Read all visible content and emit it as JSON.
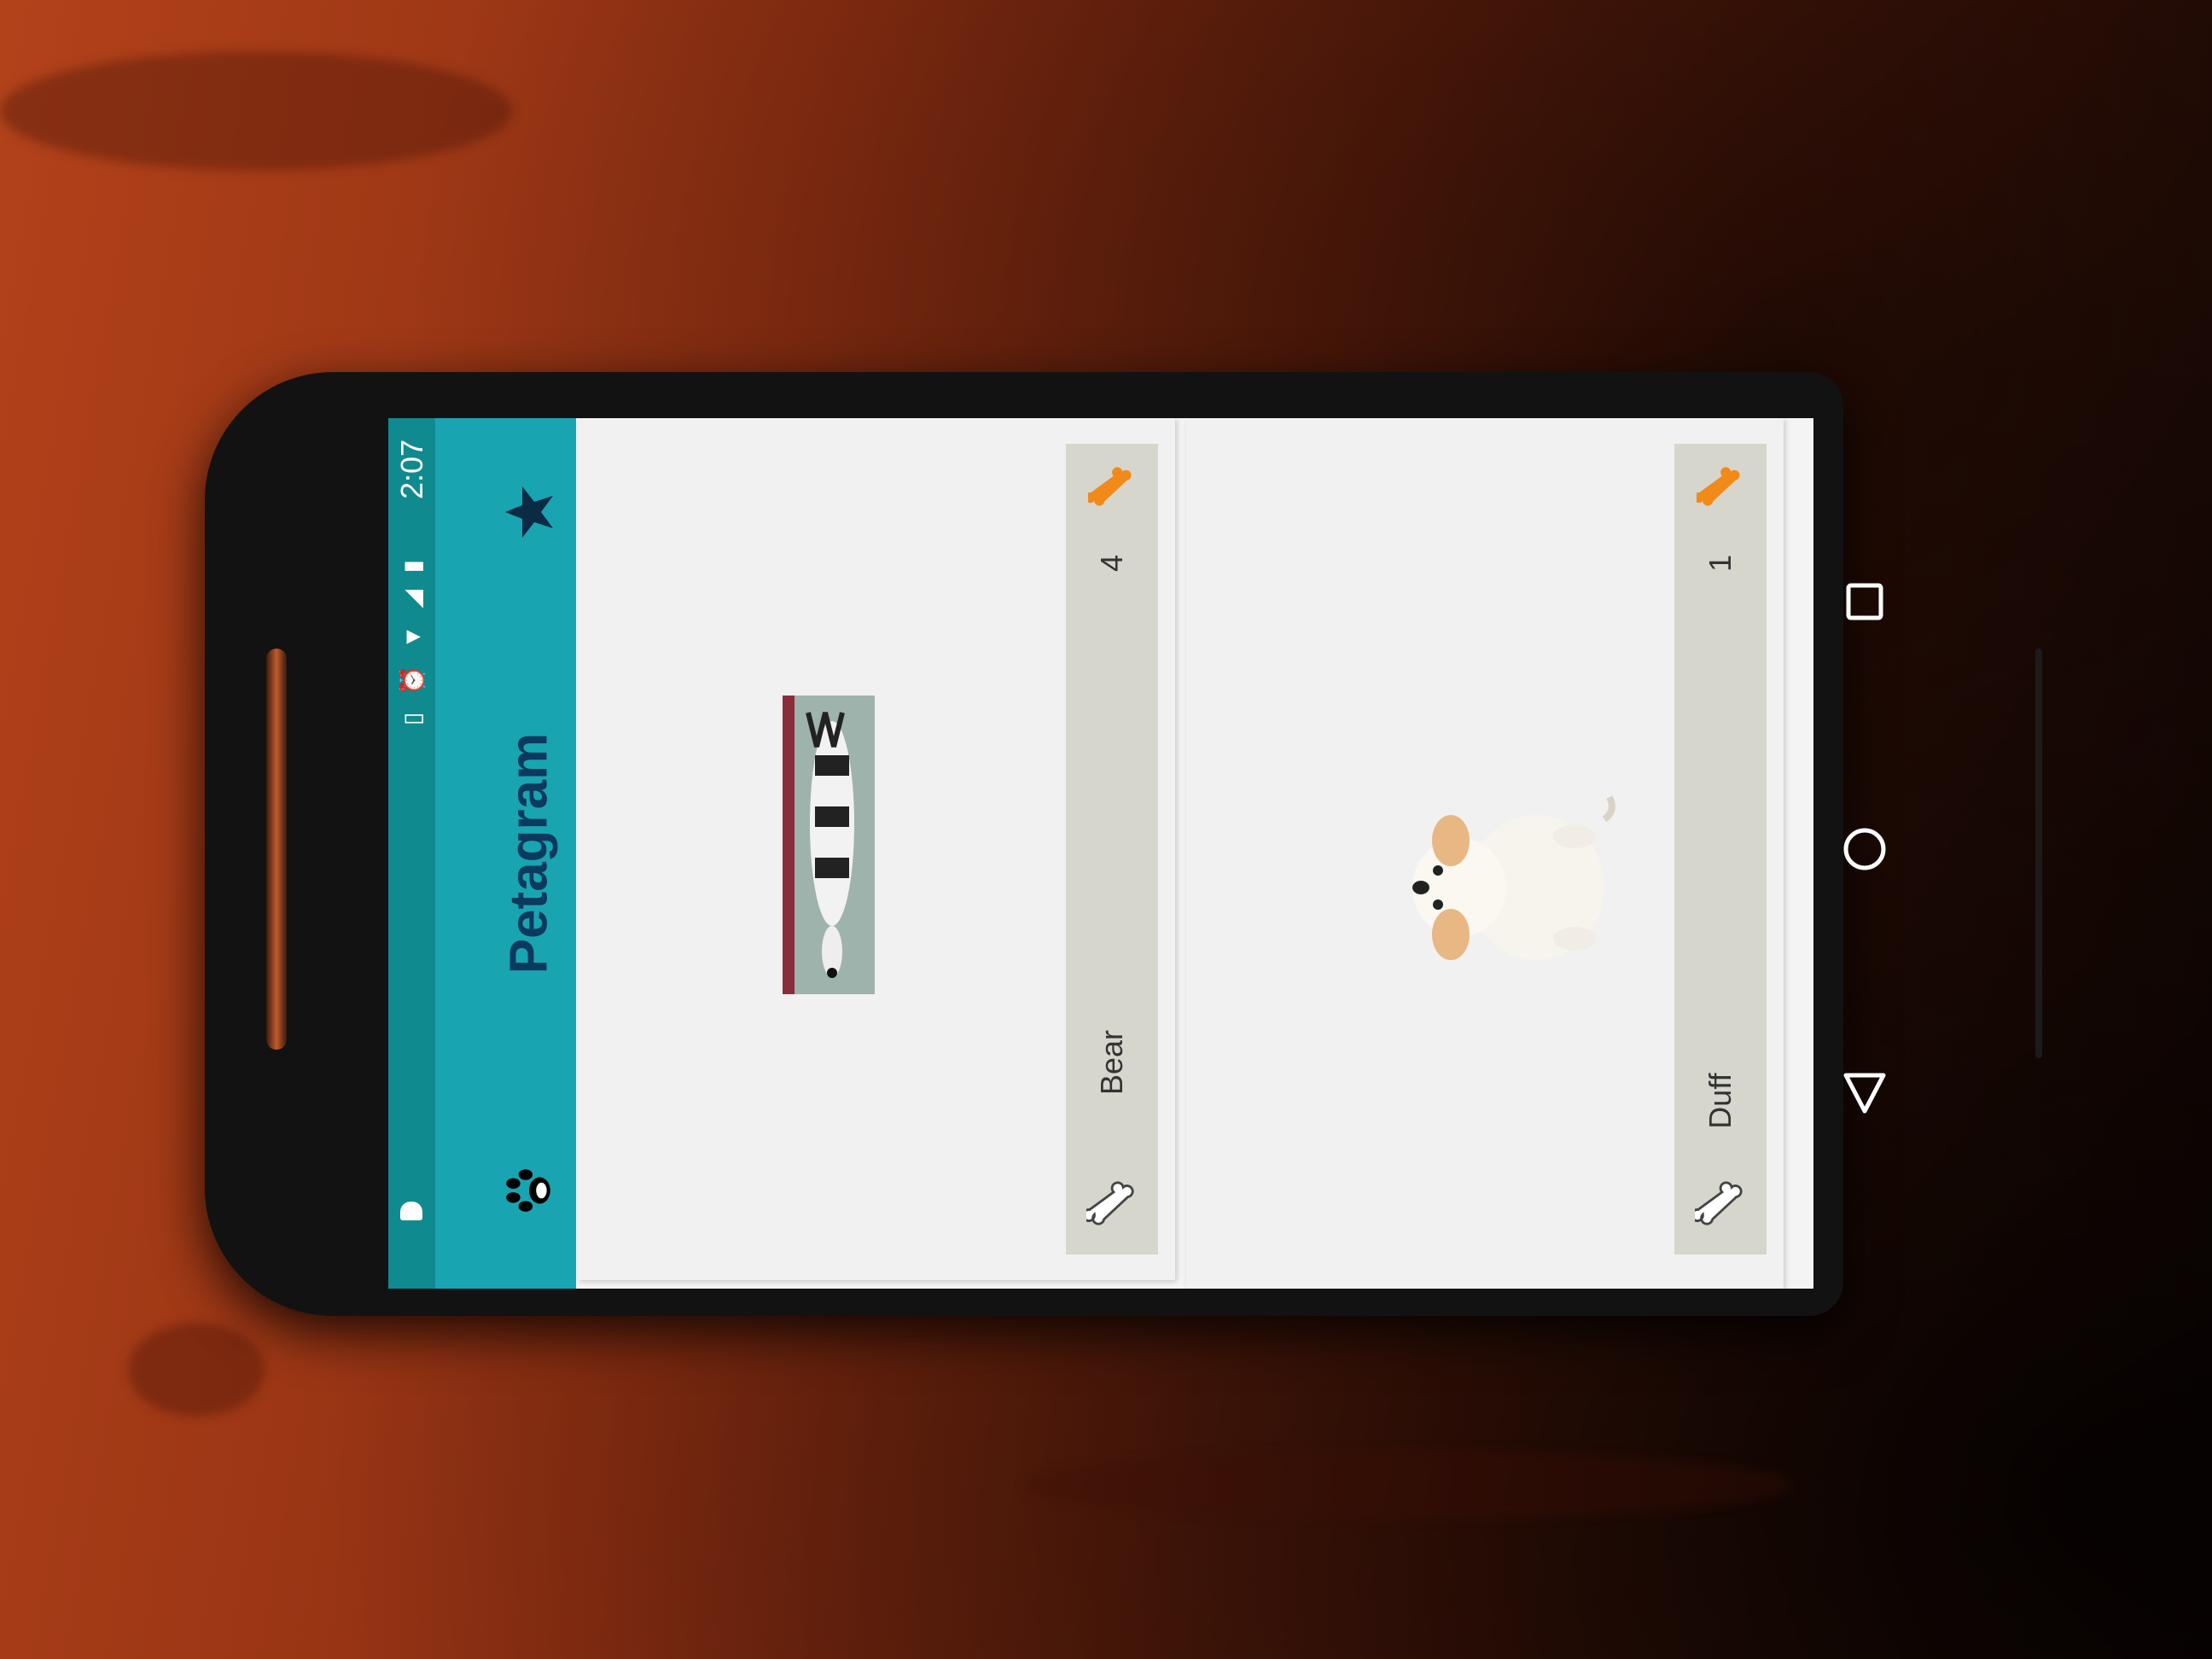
{
  "status_bar": {
    "time": "2:07",
    "icons": [
      "android-icon",
      "vibrate-icon",
      "alarm-icon",
      "wifi-icon",
      "signal-icon",
      "battery-charging-icon"
    ]
  },
  "toolbar": {
    "title": "Petagram",
    "paw_icon": "paw-icon",
    "favorites_icon": "star-icon",
    "color": "#19a4b1",
    "title_color": "#0b3a5e"
  },
  "pets": [
    {
      "name": "Bear",
      "likes": "4",
      "photo": "dog-lying-photo"
    },
    {
      "name": "Duff",
      "likes": "1",
      "photo": "puppy-sitting-photo"
    }
  ],
  "nav_bar": {
    "icons": [
      "recents-icon",
      "home-icon",
      "back-icon"
    ]
  }
}
